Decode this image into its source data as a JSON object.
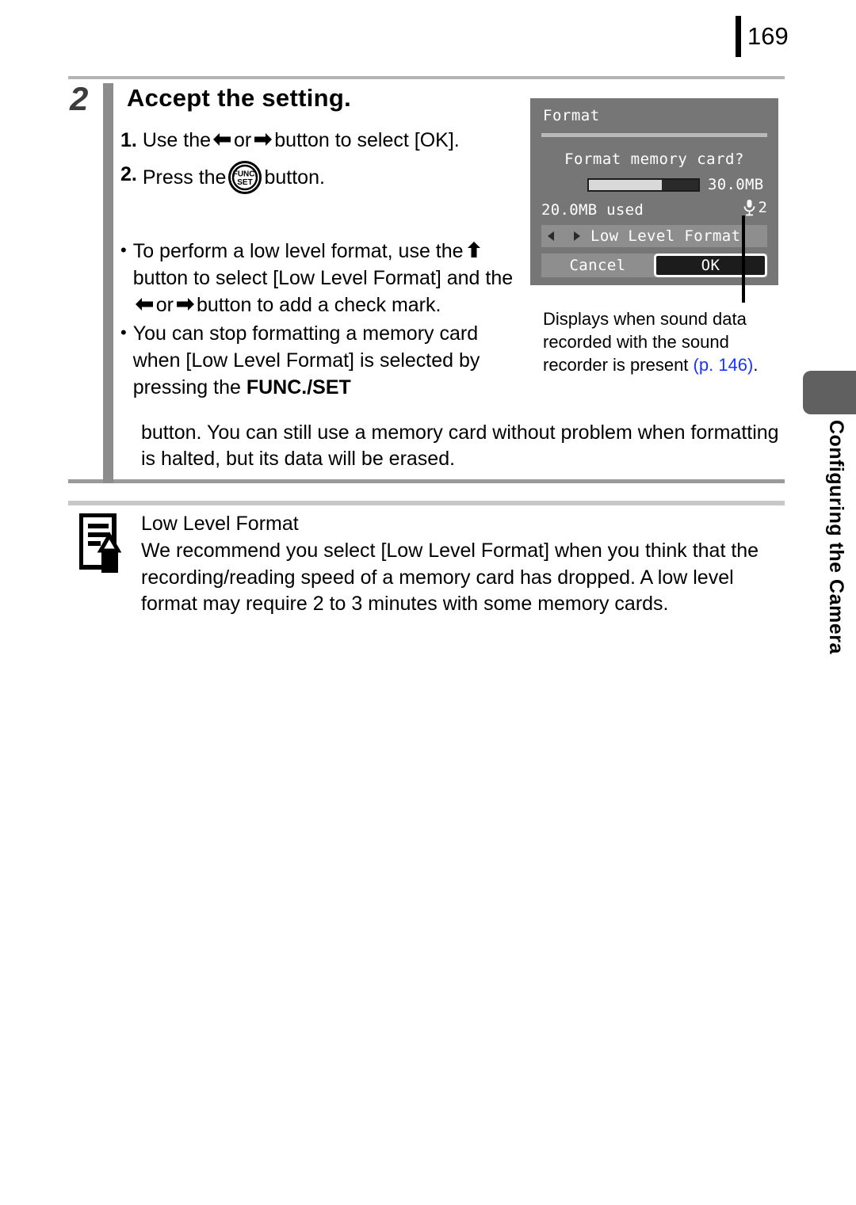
{
  "page": {
    "number": "169"
  },
  "step": {
    "number": "2",
    "heading": "Accept the setting.",
    "substeps": [
      {
        "num": "1.",
        "text_before": "Use the",
        "text_middle": "or",
        "text_after": "button to select [OK].",
        "arrow_left": "arrow-left-icon",
        "arrow_right": "arrow-right-icon"
      },
      {
        "num": "2.",
        "text_before": "Press the",
        "text_after": "button.",
        "button_icon": "func-set-button-icon"
      }
    ]
  },
  "bullets": [
    {
      "seg1": "To perform a low level format, use the",
      "icon1": "arrow-up-icon",
      "seg2": "button to select [Low Level Format] and the",
      "icon2": "arrow-left-icon",
      "seg3": "or",
      "icon3": "arrow-right-icon",
      "seg4": "button to add a check mark."
    },
    {
      "seg1": "You can stop formatting a memory card when [Low Level Format] is selected by pressing the",
      "bold": "FUNC./SET"
    }
  ],
  "bullet_continuation": "button. You can still use a memory card without problem when formatting is halted, but its data will be erased.",
  "lcd": {
    "title": "Format",
    "question": "Format memory card?",
    "capacity": "30.0MB",
    "used": "20.0MB used",
    "progress_percent": 67,
    "sound_icon": "microphone-icon",
    "sound_count": "2",
    "low_level_label": "Low Level Format",
    "cancel_label": "Cancel",
    "ok_label": "OK",
    "selected_button": "OK"
  },
  "caption": {
    "line1": "Displays when sound data",
    "line2": "recorded with the sound",
    "line3_before": "recorder is present ",
    "link": "(p. 146)",
    "line3_after": "."
  },
  "note": {
    "icon": "document-pencil-icon",
    "title": "Low Level Format",
    "body": "We recommend you select [Low Level Format] when you think that the recording/reading speed of a memory card has dropped. A low level format may require 2 to 3 minutes with some memory cards."
  },
  "side_tab": {
    "label": "Configuring the Camera",
    "color": "#606060"
  }
}
